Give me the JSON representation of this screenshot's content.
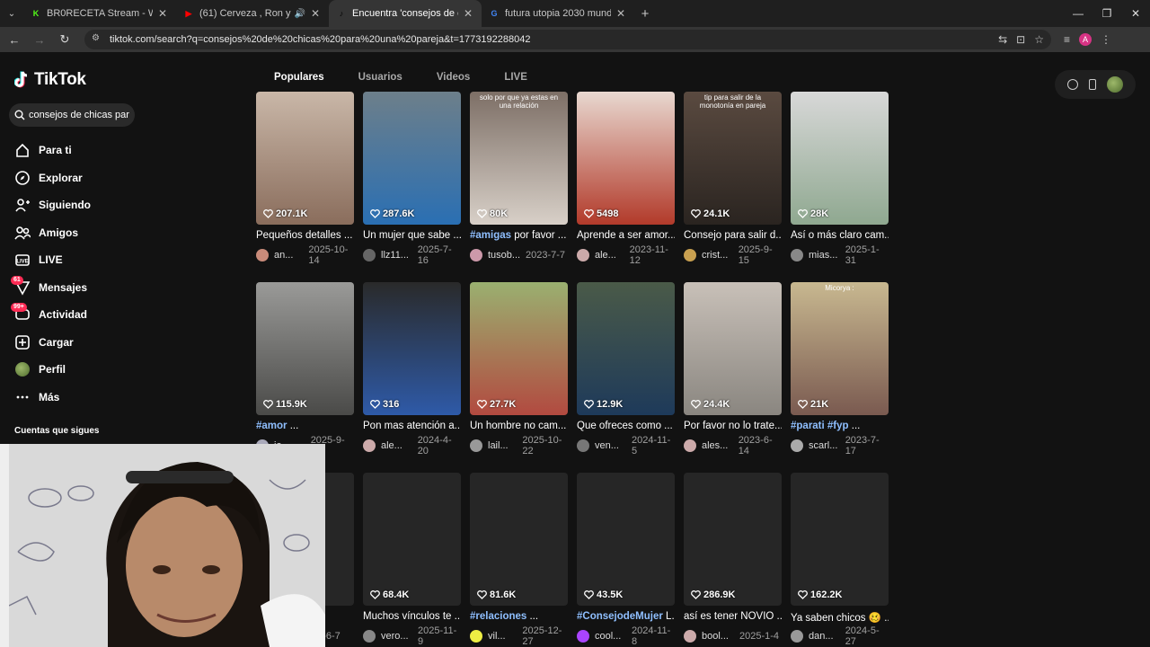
{
  "browser": {
    "tabs": [
      {
        "title": "BR0RECETA Stream - Watch Live",
        "fav": "K",
        "fav_color": "#53fc18"
      },
      {
        "title": "(61) Cerveza , Ron y Néctar",
        "fav": "▶",
        "fav_color": "#ff0000"
      },
      {
        "title": "Encuentra 'consejos de chicas p",
        "fav": "♪",
        "fav_color": "#000000"
      },
      {
        "title": "futura utopia 2030 mundo feliz",
        "fav": "G",
        "fav_color": "#4285f4"
      }
    ],
    "active_tab": 2,
    "url": "tiktok.com/search?q=consejos%20de%20chicas%20para%20una%20pareja&t=1773192288042",
    "profile_initial": "A"
  },
  "sidebar": {
    "logo": "TikTok",
    "search_value": "consejos de chicas para...",
    "items": [
      {
        "label": "Para ti",
        "icon": "home-icon"
      },
      {
        "label": "Explorar",
        "icon": "compass-icon"
      },
      {
        "label": "Siguiendo",
        "icon": "following-icon"
      },
      {
        "label": "Amigos",
        "icon": "friends-icon"
      },
      {
        "label": "LIVE",
        "icon": "live-icon"
      },
      {
        "label": "Mensajes",
        "icon": "messages-icon",
        "badge": "61"
      },
      {
        "label": "Actividad",
        "icon": "activity-icon",
        "badge": "99+"
      },
      {
        "label": "Cargar",
        "icon": "upload-icon"
      },
      {
        "label": "Perfil",
        "icon": "profile-icon"
      },
      {
        "label": "Más",
        "icon": "more-icon"
      }
    ],
    "following_heading": "Cuentas que sigues"
  },
  "tabs": [
    "Populares",
    "Usuarios",
    "Videos",
    "LIVE"
  ],
  "videos": [
    {
      "likes": "207.1K",
      "caption": "Pequeños detalles ...",
      "user": "an...",
      "date": "2025-10-14",
      "bg": "linear-gradient(#c9b7a8,#8a6d5c)",
      "av": "#c98b7a"
    },
    {
      "likes": "287.6K",
      "caption": "Un mujer que sabe ...",
      "user": "llz11...",
      "date": "2025-7-16",
      "bg": "linear-gradient(#6d7f8a,#2a6fb3)",
      "av": "#666"
    },
    {
      "likes": "80K",
      "tag": "#amigas",
      "caption": " por favor ...",
      "user": "tusob...",
      "date": "2023-7-7",
      "bg": "linear-gradient(#7d6f66,#d8d0c8)",
      "av": "#c9a"
    },
    {
      "likes": "5498",
      "caption": "Aprende a ser amor...",
      "user": "ale...",
      "date": "2023-11-12",
      "bg": "linear-gradient(#e8d8d0,#b23a2a)",
      "av": "#caa"
    },
    {
      "likes": "24.1K",
      "caption": "Consejo para salir d...",
      "user": "crist...",
      "date": "2025-9-15",
      "bg": "linear-gradient(#5a4a40,#2a2420)",
      "av": "#c8a050"
    },
    {
      "likes": "28K",
      "caption": "Así o más claro cam...",
      "user": "mias...",
      "date": "2025-1-31",
      "bg": "linear-gradient(#d8d8d8,#8fa890)",
      "av": "#888"
    },
    {
      "likes": "115.9K",
      "tag": "#amor",
      "caption": " ...",
      "user": "ja...",
      "date": "2025-9-27",
      "bg": "linear-gradient(#9a9a98,#4a4a48)",
      "av": "#aab"
    },
    {
      "likes": "316",
      "caption": "Pon mas atención a...",
      "user": "ale...",
      "date": "2024-4-20",
      "bg": "linear-gradient(#2a2a2a,#2e5aa8)",
      "av": "#caa"
    },
    {
      "likes": "27.7K",
      "caption": "Un hombre no cam...",
      "user": "lail...",
      "date": "2025-10-22",
      "bg": "linear-gradient(#9ab070,#b24a40)",
      "av": "#999"
    },
    {
      "likes": "12.9K",
      "caption": "Que ofreces como ...",
      "user": "ven...",
      "date": "2024-11-5",
      "bg": "linear-gradient(#4a5a48,#1e3a5a)",
      "av": "#777"
    },
    {
      "likes": "24.4K",
      "caption": "Por favor no lo trate...",
      "user": "ales...",
      "date": "2023-6-14",
      "bg": "linear-gradient(#c8c0b8,#8a8680)",
      "av": "#caa"
    },
    {
      "likes": "21K",
      "tag": "#parati #fyp",
      "caption": " ...",
      "user": "scarl...",
      "date": "2023-7-17",
      "bg": "linear-gradient(#c8b890,#7a5a50)",
      "av": "#aaa"
    },
    {
      "likes": "",
      "caption": "... cui...",
      "user": "",
      "date": "23-6-7",
      "bg": "#262626",
      "av": "#555"
    },
    {
      "likes": "68.4K",
      "caption": "Muchos vínculos te ...",
      "user": "vero...",
      "date": "2025-11-9",
      "bg": "#262626",
      "av": "#888"
    },
    {
      "likes": "81.6K",
      "tag": "#relaciones",
      "caption": " ...",
      "user": "vil...",
      "date": "2025-12-27",
      "bg": "#262626",
      "av": "#ee4"
    },
    {
      "likes": "43.5K",
      "tag": "#ConsejodeMujer",
      "caption": " L...",
      "user": "cool...",
      "date": "2024-11-8",
      "bg": "#262626",
      "av": "#a4f"
    },
    {
      "likes": "286.9K",
      "caption": "así es tener NOVIO ...",
      "user": "bool...",
      "date": "2025-1-4",
      "bg": "#262626",
      "av": "#caa"
    },
    {
      "likes": "162.2K",
      "caption": "Ya saben chicos 🥴 ...",
      "user": "dan...",
      "date": "2024-5-27",
      "bg": "#262626",
      "av": "#999"
    }
  ],
  "thumb_texts": {
    "v0": "",
    "v2": "solo por que ya estas en una relación",
    "v4": "tip para salir de la monotonía en pareja",
    "v11": "Micorya : "
  }
}
